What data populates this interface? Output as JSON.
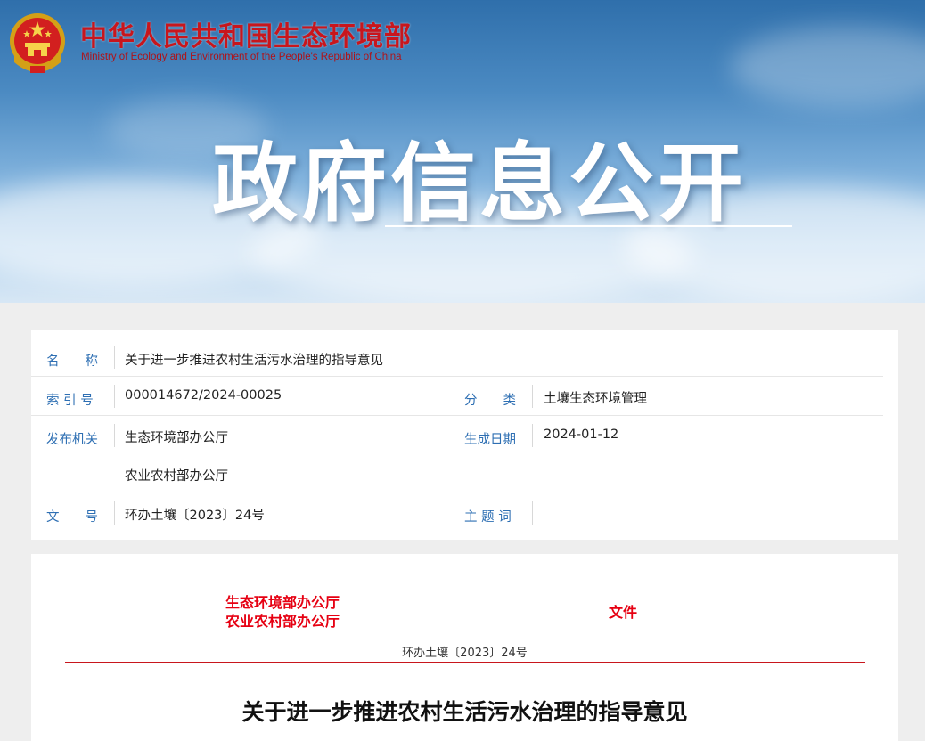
{
  "header": {
    "site_name_cn": "中华人民共和国生态环境部",
    "site_name_en": "Ministry of Ecology and Environment of the People's Republic of China",
    "banner_title": "政府信息公开",
    "emblem_icon": "national-emblem-icon"
  },
  "meta": {
    "name_label": "名　　称",
    "name_value": "关于进一步推进农村生活污水治理的指导意见",
    "index_label": "索 引 号",
    "index_value": "000014672/2024-00025",
    "category_label": "分　　类",
    "category_value": "土壤生态环境管理",
    "publisher_label": "发布机关",
    "publisher_values": [
      "生态环境部办公厅",
      "农业农村部办公厅"
    ],
    "date_label": "生成日期",
    "date_value": "2024-01-12",
    "docno_label": "文　　号",
    "docno_value": "环办土壤〔2023〕24号",
    "subject_label": "主 题 词",
    "subject_value": ""
  },
  "document": {
    "issuers": [
      "生态环境部办公厅",
      "农业农村部办公厅"
    ],
    "doc_type": "文件",
    "doc_number": "环办土壤〔2023〕24号",
    "title": "关于进一步推进农村生活污水治理的指导意见"
  },
  "colors": {
    "brand_red": "#c8161d",
    "label_blue": "#2e6fb3",
    "document_red": "#e60012"
  }
}
